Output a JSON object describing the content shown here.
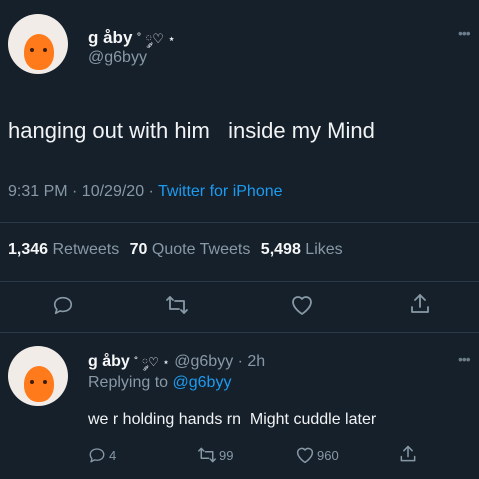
{
  "main_tweet": {
    "display_name": "g åby",
    "name_emoji": "˚ ༘♡ ⋆",
    "handle": "@g6byy",
    "text": "hanging out with him   inside my Mind",
    "time": "9:31 PM · 10/29/20 · ",
    "source": "Twitter for iPhone",
    "stats": {
      "retweets_count": "1,346",
      "retweets_label": "Retweets",
      "quotes_count": "70",
      "quotes_label": "Quote Tweets",
      "likes_count": "5,498",
      "likes_label": "Likes"
    },
    "more_icon": "more-horizontal-icon"
  },
  "reply": {
    "display_name": "g åby",
    "name_emoji": "˚ ༘♡ ⋆",
    "handle_time": "@g6byy · 2h",
    "replying_prefix": "Replying to ",
    "replying_handle": "@g6byy",
    "text": "we r holding hands rn  Might cuddle later",
    "reply_count": "4",
    "retweet_count": "99",
    "like_count": "960"
  },
  "colors": {
    "background": "#15202b",
    "accent": "#1d9bf0",
    "muted": "#8899a6"
  }
}
